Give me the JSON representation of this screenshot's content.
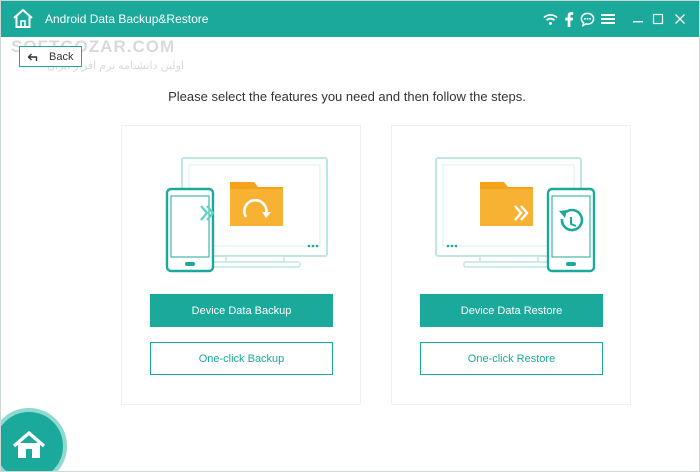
{
  "window": {
    "title": "Android Data Backup&Restore",
    "accent_color": "#1aa99a"
  },
  "titlebar_icons": [
    "wifi-icon",
    "facebook-icon",
    "chat-icon",
    "menu-icon",
    "minimize-icon",
    "maximize-icon",
    "close-icon"
  ],
  "watermark": {
    "text": "SOFTGOZAR.COM",
    "subtext": "اولین دانشنامه نرم افزار ایران"
  },
  "nav": {
    "back_label": "Back"
  },
  "main": {
    "instruction": "Please select the features you need and then follow the steps."
  },
  "cards": {
    "backup": {
      "primary_label": "Device Data Backup",
      "secondary_label": "One-click Backup"
    },
    "restore": {
      "primary_label": "Device Data Restore",
      "secondary_label": "One-click Restore"
    }
  }
}
